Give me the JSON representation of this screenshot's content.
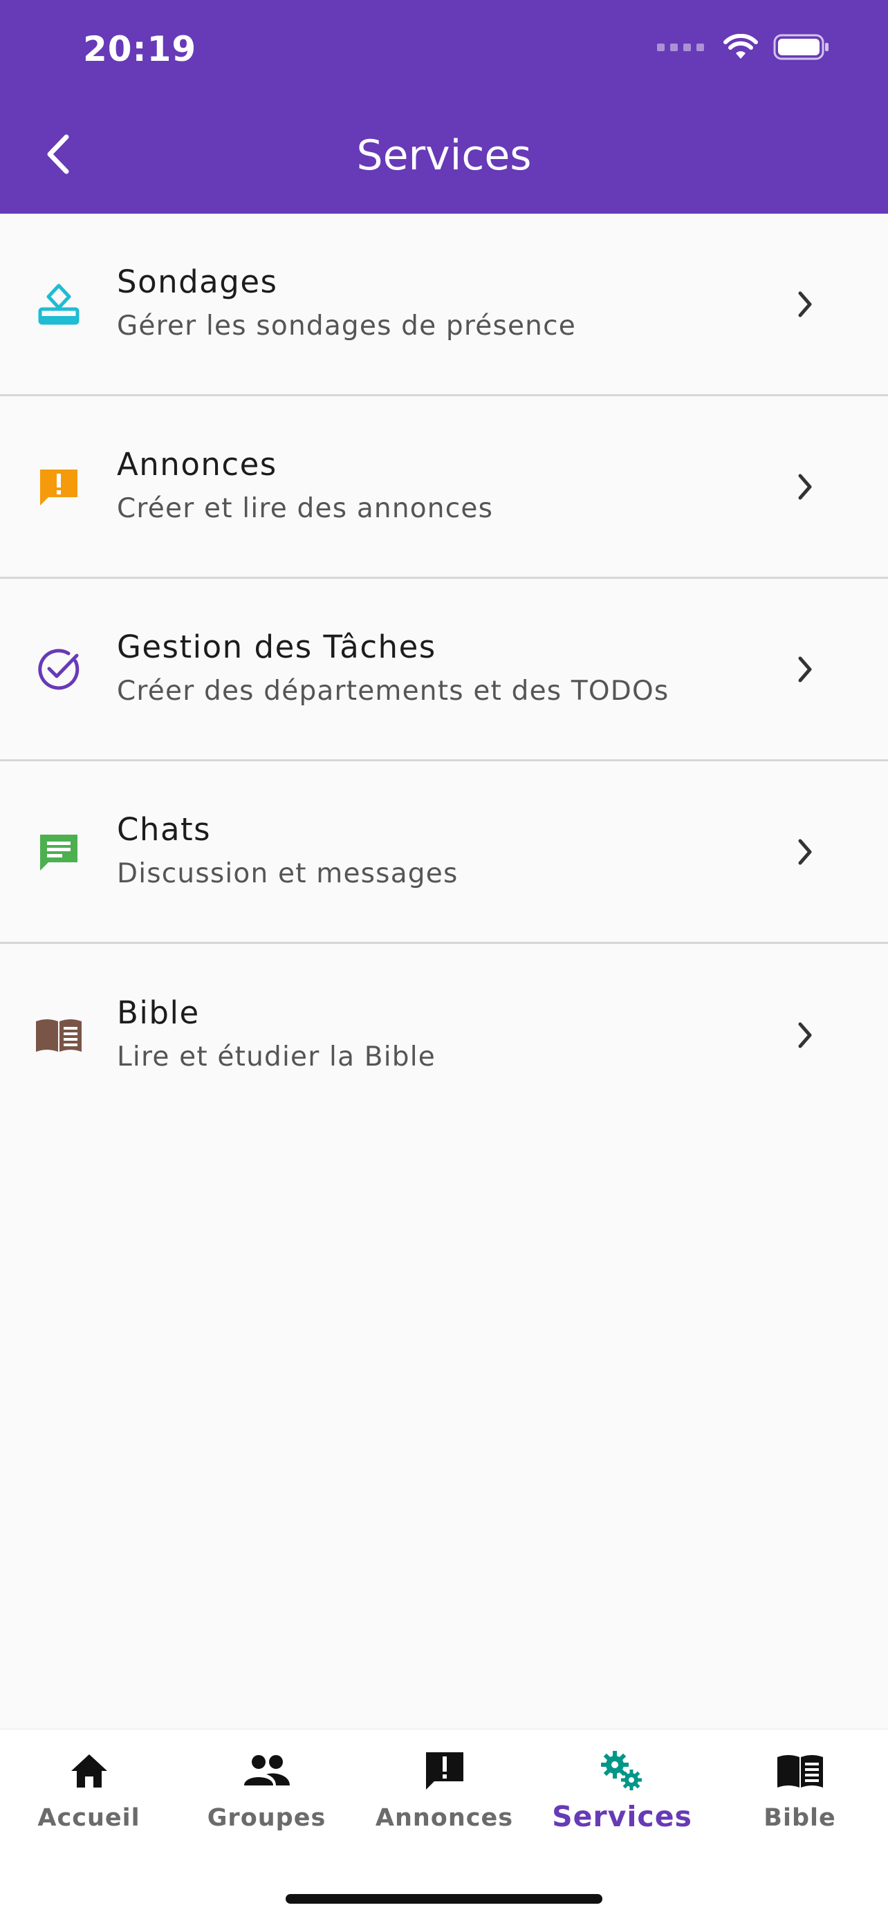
{
  "status_bar": {
    "time": "20:19"
  },
  "header": {
    "title": "Services"
  },
  "services": [
    {
      "title": "Sondages",
      "subtitle": "Gérer les sondages de présence",
      "icon": "poll-icon",
      "color": "#1fbcd3"
    },
    {
      "title": "Annonces",
      "subtitle": "Créer et lire des annonces",
      "icon": "announcement-icon",
      "color": "#f59a0a"
    },
    {
      "title": "Gestion des Tâches",
      "subtitle": "Créer des départements et des TODOs",
      "icon": "task-check-icon",
      "color": "#673ab7"
    },
    {
      "title": "Chats",
      "subtitle": "Discussion et messages",
      "icon": "chat-icon",
      "color": "#4caf50"
    },
    {
      "title": "Bible",
      "subtitle": "Lire et étudier la Bible",
      "icon": "book-icon",
      "color": "#795548"
    }
  ],
  "nav": {
    "active": "Services",
    "active_color": "#673ab7",
    "active_icon_color": "#009688",
    "tabs": [
      {
        "label": "Accueil",
        "icon": "home-icon"
      },
      {
        "label": "Groupes",
        "icon": "people-icon"
      },
      {
        "label": "Annonces",
        "icon": "announcement-icon"
      },
      {
        "label": "Services",
        "icon": "gears-icon"
      },
      {
        "label": "Bible",
        "icon": "book-icon"
      }
    ]
  },
  "colors": {
    "primary": "#673ab7",
    "background": "#fafafa"
  }
}
